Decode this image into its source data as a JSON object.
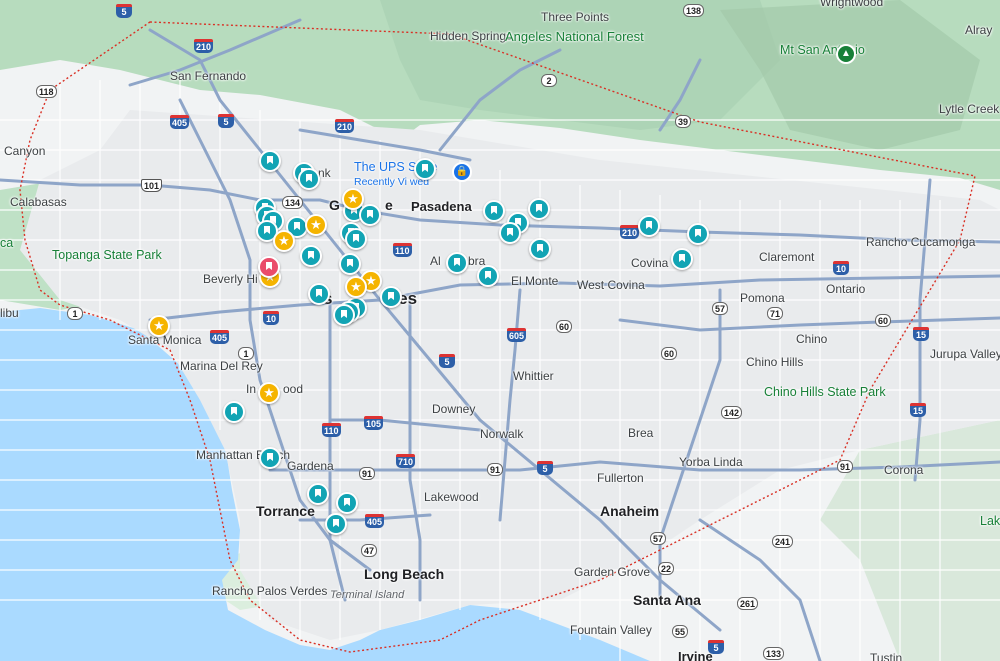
{
  "map": {
    "colors": {
      "water": "#aadaff",
      "land": "#f1f3f4",
      "urban": "#e8eaed",
      "park": "#c6e9cf",
      "forest": "#b7dcbe",
      "mountain": "#a7cfb0",
      "highway": "#8ea5c8",
      "road": "#ffffff",
      "boundary": "#d93025",
      "saved_pin": "#12a4b4",
      "starred_pin": "#f5b400",
      "selected_pin": "#ea4c6a"
    },
    "places": {
      "san_fernando": "San Fernando",
      "canyon": "Canyon",
      "calabasas": "Calabasas",
      "topanga": "Topanga State Park",
      "malibu": "libu",
      "ca_edge": "ca",
      "beverly_hills": "Beverly Hi",
      "santa_monica": "Santa Monica",
      "marina_del_rey": "Marina Del Rey",
      "inglewood_a": "In",
      "inglewood_b": "ood",
      "manhattan_beach": "Manhattan Beach",
      "gardena": "Gardena",
      "torrance": "Torrance",
      "rancho_palos_verdes": "Rancho Palos Verdes",
      "terminal_island": "Terminal Island",
      "long_beach": "Long Beach",
      "los_angeles_a": "s",
      "los_angeles_b": "eles",
      "burbank": "nk",
      "glendale_a": "G",
      "glendale_b": "e",
      "pasadena": "Pasadena",
      "alhambra_a": "Al",
      "alhambra_b": "bra",
      "el_monte": "El Monte",
      "west_covina": "West Covina",
      "covina": "Covina",
      "claremont": "Claremont",
      "rancho_cucamonga": "Rancho Cucamonga",
      "pomona": "Pomona",
      "ontario": "Ontario",
      "chino": "Chino",
      "chino_hills": "Chino Hills",
      "chino_hills_sp": "Chino Hills State Park",
      "jurupa_valley": "Jurupa Valley",
      "corona": "Corona",
      "lake_edge": "Lak",
      "whittier": "Whittier",
      "downey": "Downey",
      "norwalk": "Norwalk",
      "brea": "Brea",
      "yorba_linda": "Yorba Linda",
      "fullerton": "Fullerton",
      "lakewood": "Lakewood",
      "anaheim": "Anaheim",
      "garden_grove": "Garden Grove",
      "santa_ana": "Santa Ana",
      "fountain_valley": "Fountain Valley",
      "irvine": "Irvine",
      "tustin_edge": "Tustin",
      "three_points": "Three Points",
      "hidden_springs": "Hidden Springs",
      "angeles_nf": "Angeles National Forest",
      "mt_san_antonio": "Mt San Antonio",
      "wrightwood": "Wrightwood",
      "alray": "Alray",
      "lytle_creek": "Lytle Creek"
    },
    "ups": {
      "title": "The UPS Sto e",
      "subtitle": "Recently Vi wed"
    },
    "routes": {
      "i5_top": "5",
      "i210_a": "210",
      "i210_b": "210",
      "i210_c": "210",
      "i405_a": "405",
      "i405_b": "405",
      "i405_c": "405",
      "i5_a": "5",
      "i5_b": "5",
      "i5_c": "5",
      "i5_d": "5",
      "i10_a": "10",
      "i10_b": "10",
      "i110_a": "110",
      "i110_b": "110",
      "i105": "105",
      "i710": "710",
      "i605": "605",
      "i15_a": "15",
      "i15_b": "15",
      "us101": "101",
      "ca134": "134",
      "ca118": "118",
      "ca1_a": "1",
      "ca1_b": "1",
      "ca2": "2",
      "ca39": "39",
      "ca57_a": "57",
      "ca57_b": "57",
      "ca60_a": "60",
      "ca60_b": "60",
      "ca60_c": "60",
      "ca71": "71",
      "ca91_a": "91",
      "ca91_b": "91",
      "ca91_c": "91",
      "ca142": "142",
      "ca241": "241",
      "ca261": "261",
      "ca133": "133",
      "ca55": "55",
      "ca22": "22",
      "ca47": "47",
      "ca138": "138"
    },
    "icons": {
      "saved": "bookmark-icon",
      "starred": "star-icon",
      "ups": "shopping-bag-icon",
      "peak": "mountain-icon"
    },
    "star_glyph": "★",
    "ups_glyph": "🔒",
    "peak_glyph": "▲"
  }
}
